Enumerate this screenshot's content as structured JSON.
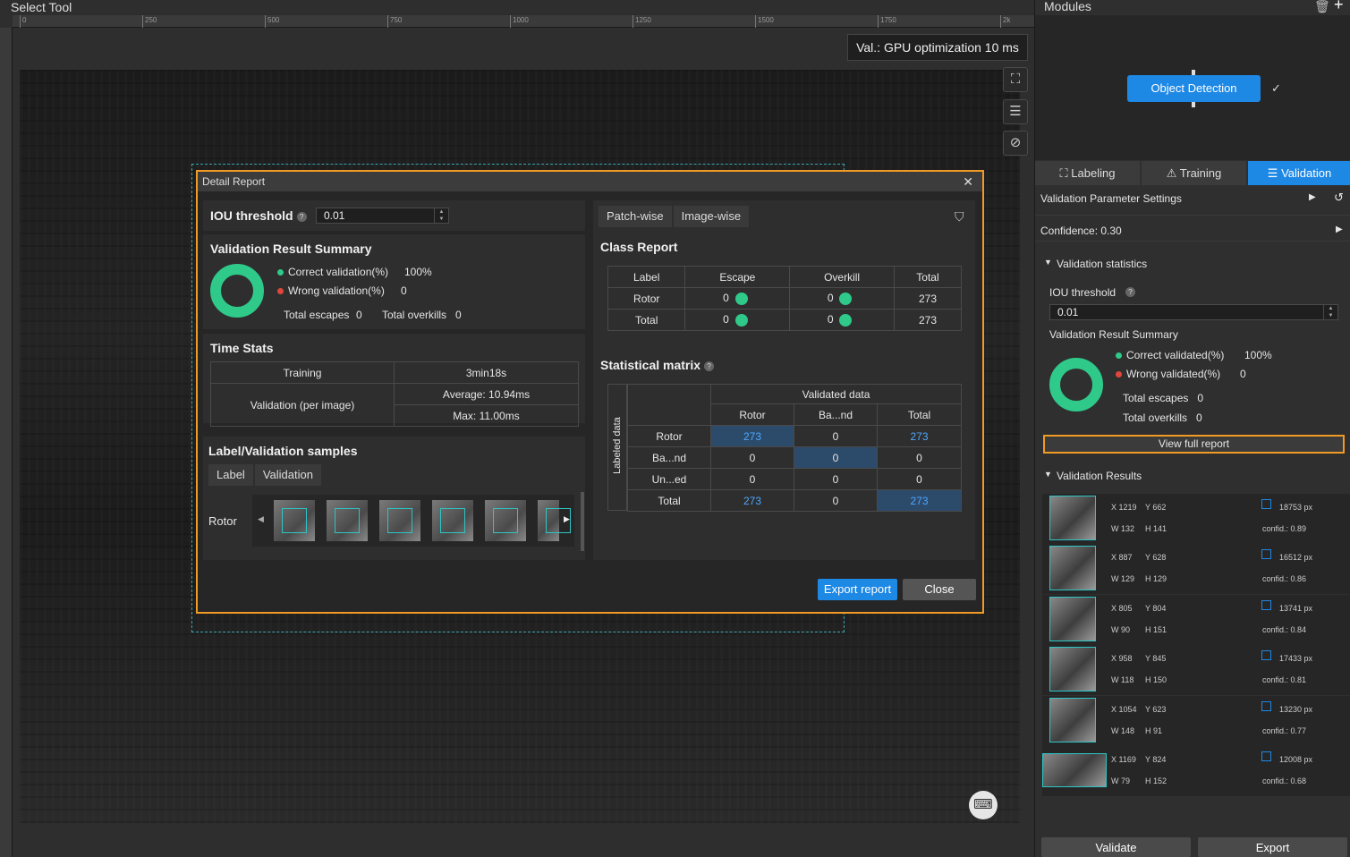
{
  "left": {
    "tool_title": "Select Tool",
    "ruler_ticks": [
      "0",
      "250",
      "500",
      "750",
      "1000",
      "1250",
      "1500",
      "1750",
      "2k"
    ],
    "val_badge": "Val.: GPU optimization 10 ms",
    "tool_icons": [
      "bounding-box-icon",
      "list-check-icon",
      "erase-label-icon"
    ],
    "keyboard_icon": "keyboard-icon"
  },
  "dialog": {
    "title": "Detail Report",
    "close_glyph": "✕",
    "iou_label": "IOU threshold",
    "iou_value": "0.01",
    "summary": {
      "title": "Validation Result Summary",
      "correct_label": "Correct validation(%)",
      "correct_value": "100%",
      "wrong_label": "Wrong validation(%)",
      "wrong_value": "0",
      "escapes_label": "Total escapes",
      "escapes_value": "0",
      "overkills_label": "Total overkills",
      "overkills_value": "0"
    },
    "time_stats": {
      "title": "Time Stats",
      "training_label": "Training",
      "training_value": "3min18s",
      "validation_label": "Validation (per image)",
      "average": "Average: 10.94ms",
      "max": "Max: 11.00ms"
    },
    "samples": {
      "title": "Label/Validation samples",
      "tab_label": "Label",
      "tab_validation": "Validation",
      "row_label": "Rotor"
    },
    "right_tabs": {
      "patch": "Patch-wise",
      "image": "Image-wise"
    },
    "class_report": {
      "title": "Class Report",
      "headers": [
        "Label",
        "Escape",
        "Overkill",
        "Total"
      ],
      "rows": [
        {
          "label": "Rotor",
          "escape": "0",
          "overkill": "0",
          "total": "273"
        },
        {
          "label": "Total",
          "escape": "0",
          "overkill": "0",
          "total": "273"
        }
      ]
    },
    "matrix": {
      "title": "Statistical matrix",
      "top_header": "Validated data",
      "side_header": "Labeled data",
      "cols": [
        "Rotor",
        "Ba...nd",
        "Total"
      ],
      "rows": [
        {
          "label": "Rotor",
          "values": [
            "273",
            "0",
            "273"
          ]
        },
        {
          "label": "Ba...nd",
          "values": [
            "0",
            "0",
            "0"
          ]
        },
        {
          "label": "Un...ed",
          "values": [
            "0",
            "0",
            "0"
          ]
        },
        {
          "label": "Total",
          "values": [
            "273",
            "0",
            "273"
          ]
        }
      ]
    },
    "export_btn": "Export report",
    "close_btn": "Close"
  },
  "right": {
    "modules_title": "Modules",
    "object_detection": "Object Detection",
    "tabs": {
      "labeling": "Labeling",
      "training": "Training",
      "validation": "Validation"
    },
    "param_settings": "Validation Parameter Settings",
    "confidence": "Confidence: 0.30",
    "stats_title": "Validation statistics",
    "iou_label": "IOU threshold",
    "iou_value": "0.01",
    "summary_title": "Validation Result Summary",
    "correct_label": "Correct validated(%)",
    "correct_value": "100%",
    "wrong_label": "Wrong validated(%)",
    "wrong_value": "0",
    "escapes": "Total escapes   0",
    "overkills": "Total overkills   0",
    "full_report_btn": "View full report",
    "results_title": "Validation Results",
    "results": [
      {
        "x": "1219",
        "y": "662",
        "w": "132",
        "h": "141",
        "px": "18753 px",
        "conf": "confid.: 0.89"
      },
      {
        "x": "887",
        "y": "628",
        "w": "129",
        "h": "129",
        "px": "16512 px",
        "conf": "confid.: 0.86"
      },
      {
        "x": "805",
        "y": "804",
        "w": "90",
        "h": "151",
        "px": "13741 px",
        "conf": "confid.: 0.84"
      },
      {
        "x": "958",
        "y": "845",
        "w": "118",
        "h": "150",
        "px": "17433 px",
        "conf": "confid.: 0.81"
      },
      {
        "x": "1054",
        "y": "623",
        "w": "148",
        "h": "91",
        "px": "13230 px",
        "conf": "confid.: 0.77"
      },
      {
        "x": "1169",
        "y": "824",
        "w": "79",
        "h": "152",
        "px": "12008 px",
        "conf": "confid.: 0.68"
      }
    ],
    "validate_btn": "Validate",
    "export_btn": "Export"
  },
  "colors": {
    "accent": "#1e88e5",
    "highlight": "#f19a25",
    "success": "#2fc98a",
    "error": "#e0463c"
  }
}
